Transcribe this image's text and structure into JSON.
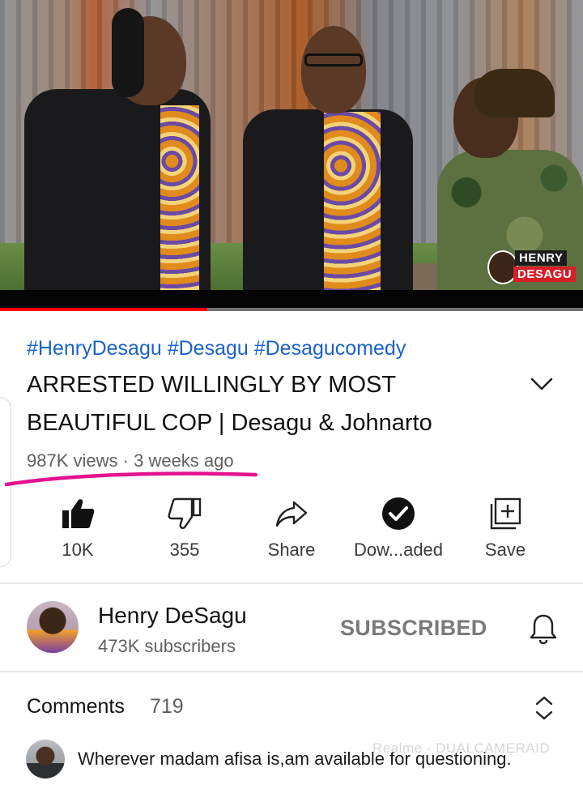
{
  "video": {
    "watermark_line1": "HENRY",
    "watermark_line2": "DESAGU",
    "progress_fraction": 0.355,
    "progress_color": "#ff0000"
  },
  "info": {
    "hashtags": "#HenryDesagu #Desagu #Desagucomedy",
    "title": "ARRESTED WILLINGLY BY MOST BEAUTIFUL COP | Desagu & Johnarto",
    "views": "987K views",
    "separator": "·",
    "age": "3 weeks ago",
    "highlight_color": "#e3128f"
  },
  "actions": [
    {
      "label": "10K",
      "icon": "thumbs-up-filled-icon"
    },
    {
      "label": "355",
      "icon": "thumbs-down-icon"
    },
    {
      "label": "Share",
      "icon": "share-arrow-icon"
    },
    {
      "label": "Dow...aded",
      "icon": "downloaded-check-icon"
    },
    {
      "label": "Save",
      "icon": "add-to-playlist-icon"
    }
  ],
  "channel": {
    "name": "Henry DeSagu",
    "subscribers": "473K subscribers",
    "subscribe_state": "SUBSCRIBED"
  },
  "comments": {
    "label": "Comments",
    "count": "719",
    "first_comment": "Wherever madam afisa is,am available for questioning.",
    "overlay_watermark": "Realme · DUALCAMERAID"
  }
}
